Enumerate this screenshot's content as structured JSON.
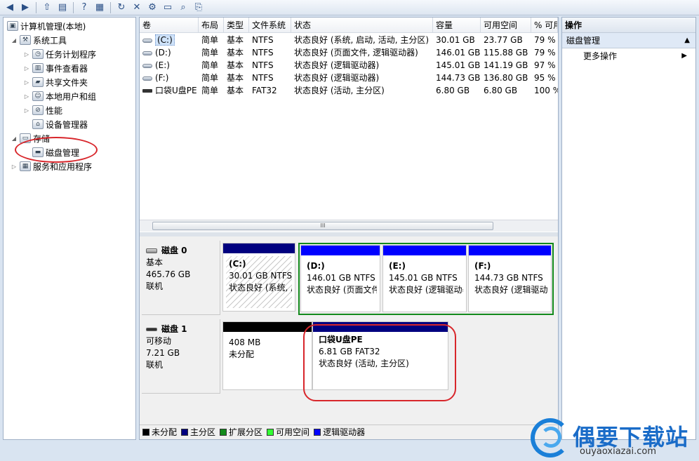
{
  "toolbar": {
    "icons": [
      "back-icon",
      "forward-icon",
      "up-icon",
      "show-hide-tree-icon",
      "help-icon",
      "properties-icon",
      "refresh-icon",
      "delete-icon",
      "settings-icon",
      "open-icon",
      "search-icon",
      "export-icon"
    ]
  },
  "tree": {
    "root": "计算机管理(本地)",
    "system_tools": "系统工具",
    "task_scheduler": "任务计划程序",
    "event_viewer": "事件查看器",
    "shared_folders": "共享文件夹",
    "local_users": "本地用户和组",
    "performance": "性能",
    "device_manager": "设备管理器",
    "storage": "存储",
    "disk_management": "磁盘管理",
    "services_apps": "服务和应用程序"
  },
  "table": {
    "headers": [
      "卷",
      "布局",
      "类型",
      "文件系统",
      "状态",
      "容量",
      "可用空间",
      "% 可用"
    ],
    "rows": [
      [
        "(C:)",
        "简单",
        "基本",
        "NTFS",
        "状态良好 (系统, 启动, 活动, 主分区)",
        "30.01 GB",
        "23.77 GB",
        "79 %"
      ],
      [
        "(D:)",
        "简单",
        "基本",
        "NTFS",
        "状态良好 (页面文件, 逻辑驱动器)",
        "146.01 GB",
        "115.88 GB",
        "79 %"
      ],
      [
        "(E:)",
        "简单",
        "基本",
        "NTFS",
        "状态良好 (逻辑驱动器)",
        "145.01 GB",
        "141.19 GB",
        "97 %"
      ],
      [
        "(F:)",
        "简单",
        "基本",
        "NTFS",
        "状态良好 (逻辑驱动器)",
        "144.73 GB",
        "136.80 GB",
        "95 %"
      ],
      [
        "口袋U盘PE",
        "简单",
        "基本",
        "FAT32",
        "状态良好 (活动, 主分区)",
        "6.80 GB",
        "6.80 GB",
        "100 %"
      ]
    ],
    "scroll_grip": "III"
  },
  "disks": [
    {
      "name": "磁盘 0",
      "type": "基本",
      "size": "465.76 GB",
      "status": "联机",
      "partitions": [
        {
          "name": "(C:)",
          "detail": "30.01 GB NTFS",
          "status": "状态良好 (系统, 启动, 活动, 主分区)"
        },
        {
          "name": "(D:)",
          "detail": "146.01 GB NTFS",
          "status": "状态良好 (页面文件, 逻辑驱动器)"
        },
        {
          "name": "(E:)",
          "detail": "145.01 GB NTFS",
          "status": "状态良好 (逻辑驱动器)"
        },
        {
          "name": "(F:)",
          "detail": "144.73 GB NTFS",
          "status": "状态良好 (逻辑驱动器)"
        }
      ]
    },
    {
      "name": "磁盘 1",
      "type": "可移动",
      "size": "7.21 GB",
      "status": "联机",
      "partitions": [
        {
          "name": "",
          "detail": "408 MB",
          "status": "未分配"
        },
        {
          "name": "口袋U盘PE",
          "detail": "6.81 GB FAT32",
          "status": "状态良好 (活动, 主分区)"
        }
      ]
    }
  ],
  "legend": [
    {
      "label": "未分配",
      "color": "#000000"
    },
    {
      "label": "主分区",
      "color": "#00007f"
    },
    {
      "label": "扩展分区",
      "color": "#138a1c"
    },
    {
      "label": "可用空间",
      "color": "#33ff33"
    },
    {
      "label": "逻辑驱动器",
      "color": "#0000ff"
    }
  ],
  "colors": {
    "primary_partition": "#00007f",
    "logical_drive": "#0000ff",
    "unallocated": "#000000",
    "extended": "#138a1c",
    "highlight_oval": "#d8262b"
  },
  "actions": {
    "title": "操作",
    "section": "磁盘管理",
    "more": "更多操作"
  },
  "watermark": {
    "title": "偶要下载站",
    "domain": "ouyaoxiazai.com"
  }
}
